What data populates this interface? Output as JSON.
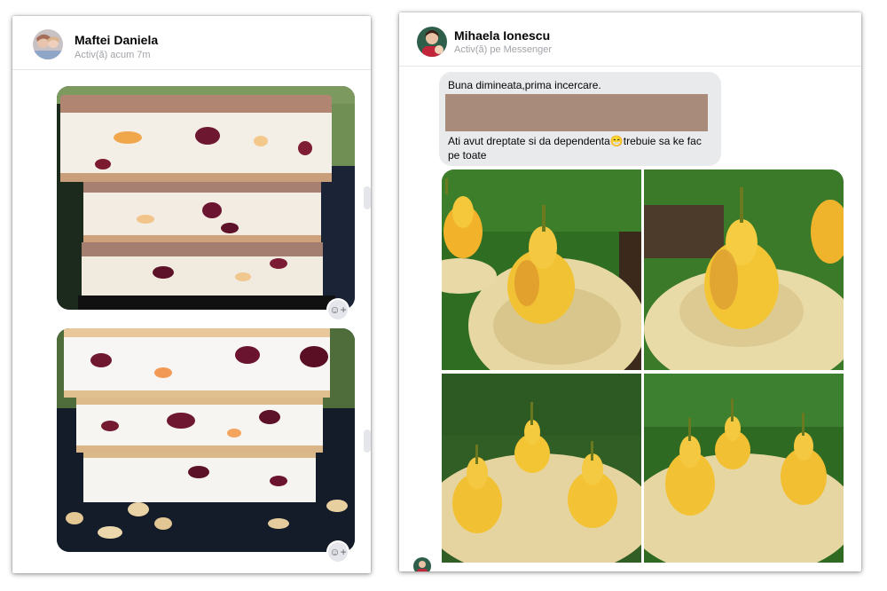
{
  "left_chat": {
    "contact_name": "Maftei Daniela",
    "status": "Activ(ă) acum 7m",
    "photos": [
      {
        "alt": "wafer-nougat-milk-chocolate-photo"
      },
      {
        "alt": "wafer-nougat-white-photo"
      }
    ],
    "react_glyph": "☺+"
  },
  "right_chat": {
    "contact_name": "Mihaela Ionescu",
    "status": "Activ(ă) pe Messenger",
    "message_line1": "Buna dimineata,prima incercare.",
    "message_line2": "Ati avut dreptate si da dependenta",
    "message_emoji": "😁",
    "message_line2_after": "trebuie sa ke fac",
    "message_line3": "pe toate"
  },
  "colors": {
    "divider": "#e4e6eb",
    "bubble": "#e9eaec",
    "redaction": "#a88b7b",
    "status_text": "#a0a3a8"
  }
}
